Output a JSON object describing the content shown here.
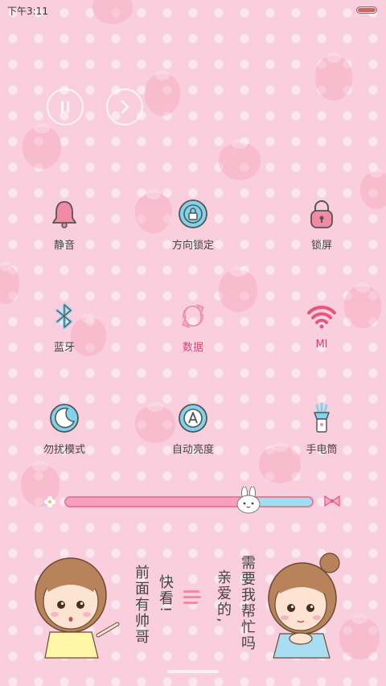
{
  "status_bar": {
    "time": "下午3:11",
    "battery_level": 1.0
  },
  "media": {
    "pause_icon": "pause-icon",
    "next_icon": "chevron-right-icon"
  },
  "toggles": [
    {
      "label": "静音",
      "icon": "bell-icon",
      "active": false
    },
    {
      "label": "方向锁定",
      "icon": "rotation-lock-icon",
      "active": false
    },
    {
      "label": "锁屏",
      "icon": "lock-icon",
      "active": false
    },
    {
      "label": "蓝牙",
      "icon": "bluetooth-icon",
      "active": false
    },
    {
      "label": "数据",
      "icon": "data-sync-icon",
      "active": true
    },
    {
      "label": "MI",
      "icon": "wifi-icon",
      "active": true
    },
    {
      "label": "勿扰模式",
      "icon": "moon-icon",
      "active": false
    },
    {
      "label": "自动亮度",
      "icon": "auto-brightness-icon",
      "active": false
    },
    {
      "label": "手电筒",
      "icon": "flashlight-icon",
      "active": false
    }
  ],
  "brightness": {
    "level": 0.74,
    "low_icon": "flower-icon",
    "high_icon": "bow-icon"
  },
  "banner": {
    "left_text": "前面有帅哥",
    "left_exclaim": "快看!",
    "right_text": "需要我帮忙吗",
    "right_text_2": "亲爱的,"
  },
  "colors": {
    "accent": "#e03e6a",
    "background": "#f9cfdd",
    "icon_pink": "#f28aa6",
    "icon_blue": "#7fd3ea"
  }
}
